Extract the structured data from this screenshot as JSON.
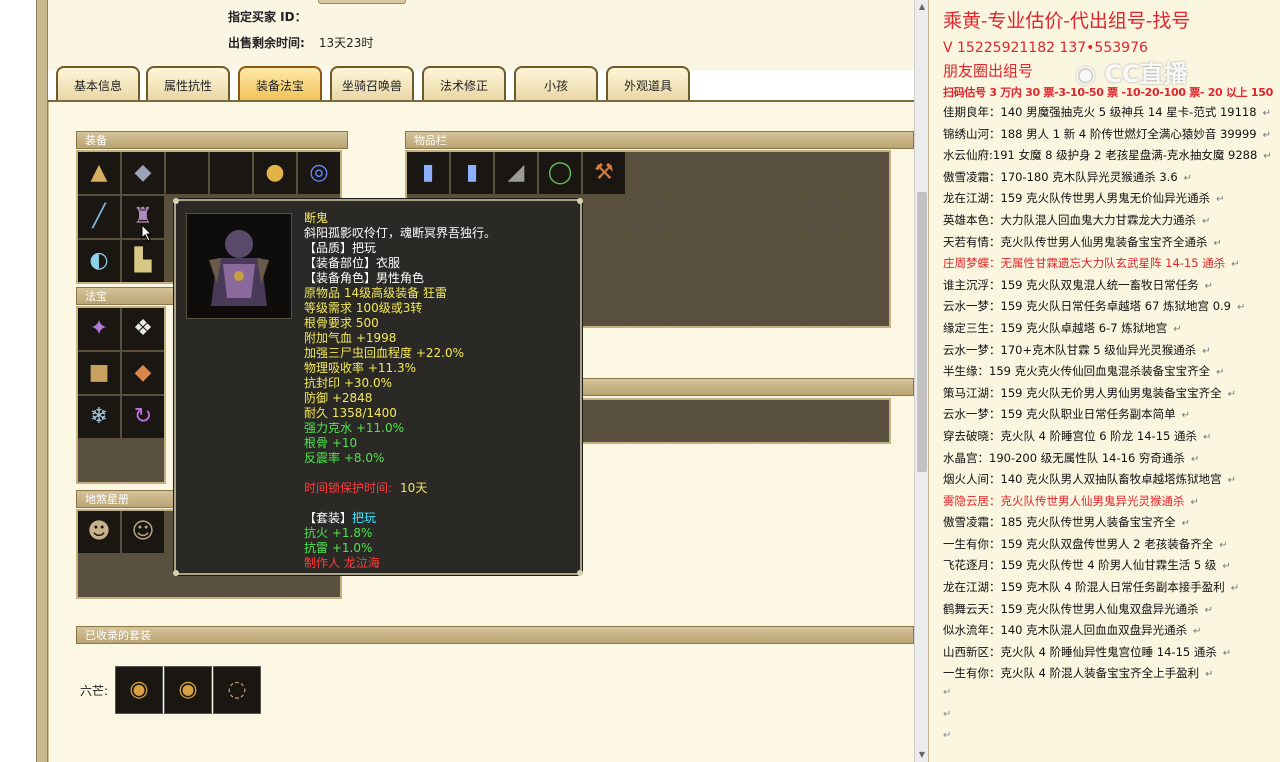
{
  "header": {
    "buyer_label": "指定买家 ID：",
    "time_label": "出售剩余时间:",
    "time_value": "13天23时"
  },
  "tabs": [
    {
      "label": "基本信息",
      "active": false
    },
    {
      "label": "属性抗性",
      "active": false
    },
    {
      "label": "装备法宝",
      "active": true
    },
    {
      "label": "坐骑召唤兽",
      "active": false
    },
    {
      "label": "法术修正",
      "active": false
    },
    {
      "label": "小孩",
      "active": false
    },
    {
      "label": "外观道具",
      "active": false
    }
  ],
  "sections": {
    "equipment": "装备",
    "treasure": "法宝",
    "star_map": "地煞星册",
    "inventory": "物品栏",
    "collected_sets": "已收录的套装",
    "set_label": "六芒:"
  },
  "tooltip": {
    "name": "断鬼",
    "lines": [
      {
        "text": "斜阳孤影叹伶仃，魂断冥界吾独行。",
        "color": "white"
      },
      {
        "text": "【品质】把玩",
        "color": "white"
      },
      {
        "text": "【装备部位】衣服",
        "color": "white"
      },
      {
        "text": "【装备角色】男性角色",
        "color": "white"
      },
      {
        "text": "原物品 14级高级装备 狂雷",
        "color": "yellow"
      },
      {
        "text": "等级需求 100级或3转",
        "color": "yellow"
      },
      {
        "text": "根骨要求 500",
        "color": "yellow"
      },
      {
        "text": "附加气血 +1998",
        "color": "yellow"
      },
      {
        "text": "加强三尸虫回血程度 +22.0%",
        "color": "yellow"
      },
      {
        "text": "物理吸收率 +11.3%",
        "color": "yellow"
      },
      {
        "text": "抗封印 +30.0%",
        "color": "yellow"
      },
      {
        "text": "防御 +2848",
        "color": "yellow"
      },
      {
        "text": "耐久 1358/1400",
        "color": "yellow"
      },
      {
        "text": "强力克水 +11.0%",
        "color": "green"
      },
      {
        "text": "根骨 +10",
        "color": "green"
      },
      {
        "text": "反震率 +8.0%",
        "color": "green"
      }
    ],
    "protect_label": "时间锁保护时间:",
    "protect_value": "10天",
    "set_label": "【套装】",
    "set_value": "把玩",
    "set_lines": [
      {
        "text": "抗火 +1.8%",
        "color": "green"
      },
      {
        "text": "抗雷 +1.0%",
        "color": "green"
      }
    ],
    "maker": "制作人 龙泣海"
  },
  "notes": {
    "title": "乘黄-专业估价-代出组号-找号",
    "phone": "V 15225921182   137•553976",
    "moments": "朋友圈出组号",
    "pricing": "扫码估号 3 万内 30 票-3-10-50 票 -10-20-100 票- 20 以上 150",
    "logo": "CC直播",
    "rows": [
      {
        "text": "佳期良年：140 男魔强抽克火 5 级神兵 14 星卡-范式 19118",
        "red": false
      },
      {
        "text": "锦绣山河：188 男人 1 新 4 阶传世燃灯全满心猿妙音 39999",
        "red": false
      },
      {
        "text": "水云仙府:191 女魔 8 级护身 2 老孩星盘满-克水抽女魔 9288",
        "red": false
      },
      {
        "text": "傲雪凌霜：170-180 克木队异光灵猴通杀 3.6",
        "red": false
      },
      {
        "text": "龙在江湖：159 克火队传世男人男鬼无价仙异光通杀",
        "red": false
      },
      {
        "text": "英雄本色：大力队混人回血鬼大力甘霖龙大力通杀",
        "red": false
      },
      {
        "text": "天若有情：克火队传世男人仙男鬼装备宝宝齐全通杀",
        "red": false
      },
      {
        "text": "庄周梦蝶：无属性甘霖遗忘大力队玄武星阵 14-15 通杀",
        "red": true
      },
      {
        "text": "谁主沉浮：159 克火队双鬼混人统一畜牧日常任务",
        "red": false
      },
      {
        "text": "云水一梦：159 克火队日常任务卓越塔 67 炼狱地宫 0.9",
        "red": false
      },
      {
        "text": "缘定三生：159 克火队卓越塔 6-7 炼狱地宫",
        "red": false
      },
      {
        "text": "云水一梦：170+克木队甘霖 5 级仙异光灵猴通杀",
        "red": false
      },
      {
        "text": "半生缘：159 克火克火传仙回血鬼混杀装备宝宝齐全",
        "red": false
      },
      {
        "text": "策马江湖：159 克火队无价男人男仙男鬼装备宝宝齐全",
        "red": false
      },
      {
        "text": "云水一梦：159 克火队职业日常任务副本简单",
        "red": false
      },
      {
        "text": "穿去破晓：克火队 4 阶睡宫位 6 阶龙 14-15 通杀",
        "red": false
      },
      {
        "text": "水晶宫：190-200 级无属性队 14-16 穷奇通杀",
        "red": false
      },
      {
        "text": "烟火人间：140 克火队男人双抽队畜牧卓越塔炼狱地宫",
        "red": false
      },
      {
        "text": "雾隐云居：克火队传世男人仙男鬼异光灵猴通杀",
        "red": true
      },
      {
        "text": "傲雪凌霜：185 克火队传世男人装备宝宝齐全",
        "red": false
      },
      {
        "text": "一生有你：159 克火队双盘传世男人 2 老孩装备齐全",
        "red": false
      },
      {
        "text": "飞花逐月：159 克火队传世 4 阶男人仙甘霖生活 5 级",
        "red": false
      },
      {
        "text": "龙在江湖：159 克木队 4 阶混人日常任务副本接手盈利",
        "red": false
      },
      {
        "text": "鹤舞云天：159 克火队传世男人仙鬼双盘异光通杀",
        "red": false
      },
      {
        "text": "似水流年：140 克木队混人回血血双盘异光通杀",
        "red": false
      },
      {
        "text": "山西新区：克火队 4 阶睡仙异性鬼宫位睡 14-15 通杀",
        "red": false
      },
      {
        "text": "一生有你：克火队 4 阶混人装备宝宝齐全上手盈利",
        "red": false
      }
    ]
  }
}
